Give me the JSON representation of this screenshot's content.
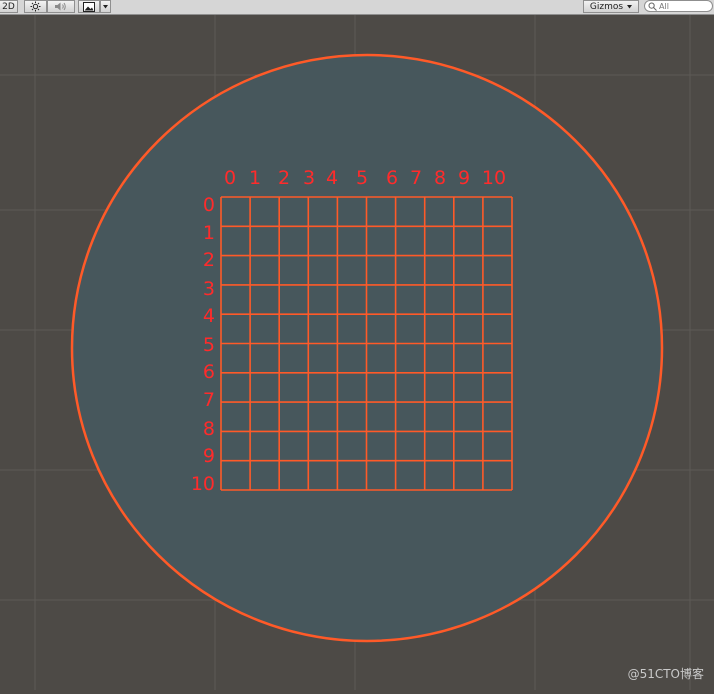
{
  "toolbar": {
    "mode_2d_label": "2D",
    "lighting_icon": "sun-icon",
    "audio_icon": "speaker-icon",
    "effects_icon": "image-icon",
    "effects_dropdown_icon": "chevron-down-icon",
    "gizmos_label": "Gizmos",
    "gizmos_dropdown_icon": "chevron-down-icon",
    "search_icon": "search-icon",
    "search_placeholder": "All"
  },
  "scene": {
    "background_color": "#4d4a46",
    "disc_fill_color": "#47575c",
    "outline_color": "#ff5a28",
    "grid_line_color": "#ff5a28",
    "label_color": "#ff2b2b",
    "column_labels": [
      "0",
      "1",
      "2",
      "3",
      "4",
      "5",
      "6",
      "7",
      "8",
      "9",
      "10"
    ],
    "row_labels": [
      "0",
      "1",
      "2",
      "3",
      "4",
      "5",
      "6",
      "7",
      "8",
      "9",
      "10"
    ]
  },
  "watermark": "@51CTO博客"
}
